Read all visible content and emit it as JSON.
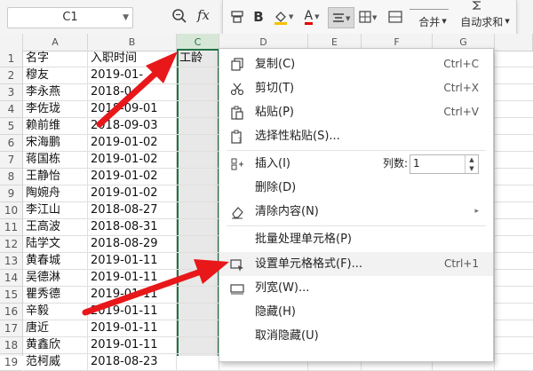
{
  "formula_bar": {
    "name_box": "C1",
    "fx_label": "fx"
  },
  "toolbar": {
    "merge_label": "合并",
    "autosum_label": "自动求和",
    "bold_label": "B",
    "font_color_letter": "A"
  },
  "columns": [
    "A",
    "B",
    "C",
    "D",
    "E",
    "F",
    "G"
  ],
  "rows": [
    {
      "num": "1",
      "name": "名字",
      "date": "入职时间",
      "c": "工龄"
    },
    {
      "num": "2",
      "name": "穆友",
      "date": "2019-01-",
      "c": ""
    },
    {
      "num": "3",
      "name": "李永燕",
      "date": "2018-0",
      "c": ""
    },
    {
      "num": "4",
      "name": "李佐珑",
      "date": "2018-09-01",
      "c": ""
    },
    {
      "num": "5",
      "name": "赖前维",
      "date": "2018-09-03",
      "c": ""
    },
    {
      "num": "6",
      "name": "宋海鹏",
      "date": "2019-01-02",
      "c": ""
    },
    {
      "num": "7",
      "name": "蒋国栋",
      "date": "2019-01-02",
      "c": ""
    },
    {
      "num": "8",
      "name": "王静怡",
      "date": "2019-01-02",
      "c": ""
    },
    {
      "num": "9",
      "name": "陶婉舟",
      "date": "2019-01-02",
      "c": ""
    },
    {
      "num": "10",
      "name": "李江山",
      "date": "2018-08-27",
      "c": ""
    },
    {
      "num": "11",
      "name": "王高波",
      "date": "2018-08-31",
      "c": ""
    },
    {
      "num": "12",
      "name": "陆学文",
      "date": "2018-08-29",
      "c": ""
    },
    {
      "num": "13",
      "name": "黄春城",
      "date": "2019-01-11",
      "c": ""
    },
    {
      "num": "14",
      "name": "吴德淋",
      "date": "2019-01-11",
      "c": ""
    },
    {
      "num": "15",
      "name": "瞿秀德",
      "date": "2019-01-11",
      "c": ""
    },
    {
      "num": "16",
      "name": "辛毅",
      "date": "2019-01-11",
      "c": ""
    },
    {
      "num": "17",
      "name": "唐近",
      "date": "2019-01-11",
      "c": ""
    },
    {
      "num": "18",
      "name": "黄鑫欣",
      "date": "2019-01-11",
      "c": ""
    },
    {
      "num": "19",
      "name": "范柯威",
      "date": "2018-08-23",
      "c": ""
    }
  ],
  "menu": {
    "copy": {
      "label": "复制(C)",
      "shortcut": "Ctrl+C"
    },
    "cut": {
      "label": "剪切(T)",
      "shortcut": "Ctrl+X"
    },
    "paste": {
      "label": "粘贴(P)",
      "shortcut": "Ctrl+V"
    },
    "paste_special": {
      "label": "选择性粘贴(S)..."
    },
    "insert": {
      "label": "插入(I)",
      "col_count_label": "列数:",
      "col_count_value": "1"
    },
    "delete": {
      "label": "删除(D)"
    },
    "clear": {
      "label": "清除内容(N)"
    },
    "batch": {
      "label": "批量处理单元格(P)"
    },
    "format_cells": {
      "label": "设置单元格格式(F)...",
      "shortcut": "Ctrl+1"
    },
    "col_width": {
      "label": "列宽(W)..."
    },
    "hide": {
      "label": "隐藏(H)"
    },
    "unhide": {
      "label": "取消隐藏(U)"
    }
  },
  "colors": {
    "accent_green": "#217346",
    "arrow_red": "#e8171a"
  }
}
